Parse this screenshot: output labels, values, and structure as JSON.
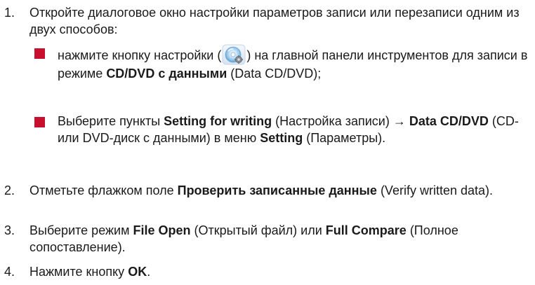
{
  "steps": [
    {
      "number": "1.",
      "text": "Откройте диалоговое окно настройки параметров записи или перезаписи одним из двух способов:",
      "bullets": [
        {
          "part1": "нажмите кнопку настройки (",
          "icon": "cd-settings-icon",
          "part2": ") на главной панели инструментов для записи в режиме ",
          "bold1": "CD/DVD с данными",
          "part3": " (Data CD/DVD);"
        },
        {
          "part1": "Выберите пункты ",
          "bold1": "Setting for writing",
          "part2": " (Настройка записи) → ",
          "bold2": "Data CD/DVD",
          "part3": " (CD- или DVD-диск с данными) в меню ",
          "bold3": "Setting",
          "part4": " (Параметры)."
        }
      ]
    },
    {
      "number": "2.",
      "part1": "Отметьте флажком поле ",
      "bold1": "Проверить записанные данные",
      "part2": " (Verify written data)."
    },
    {
      "number": "3.",
      "part1": "Выберите режим ",
      "bold1": "File Open",
      "part2": " (Открытый файл) или ",
      "bold2": "Full Compare",
      "part3": " (Полное сопоставление)."
    },
    {
      "number": "4.",
      "part1": "Нажмите кнопку ",
      "bold1": "OK",
      "part2": "."
    }
  ],
  "colors": {
    "bullet": "#c8102e",
    "text": "#1a1a1a"
  }
}
